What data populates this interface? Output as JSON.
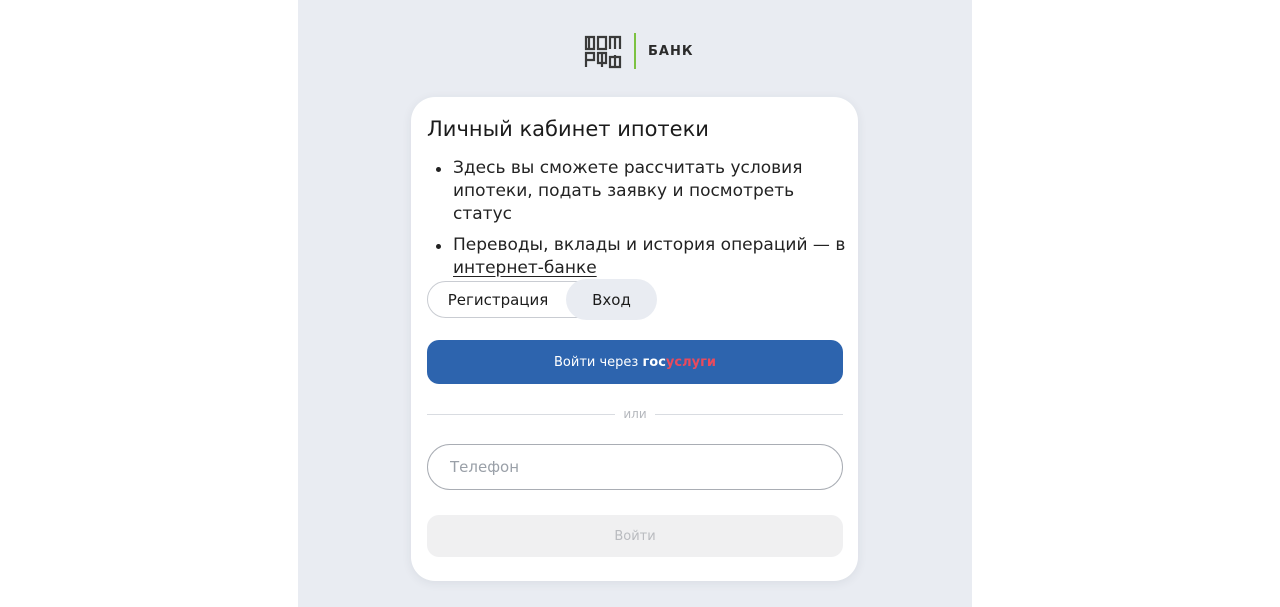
{
  "brand": {
    "logo_icon": "dom-rf-logo-icon",
    "name": "БАНК",
    "accent_color": "#7cc242"
  },
  "card": {
    "title": "Личный кабинет ипотеки",
    "bullets": [
      {
        "text": "Здесь вы сможете рассчитать условия ипотеки, подать заявку и посмотреть статус"
      },
      {
        "text": "Переводы, вклады и история операций — в ",
        "link": "интернет-банке"
      }
    ]
  },
  "tabs": {
    "register": "Регистрация",
    "login": "Вход",
    "active": "login"
  },
  "gosuslugi_button": {
    "prefix": "Войти через ",
    "brand_part1": "гос",
    "brand_part2": "услуги",
    "color": "#2d64ae"
  },
  "divider": {
    "text": "или"
  },
  "phone": {
    "placeholder": "Телефон",
    "value": ""
  },
  "submit": {
    "label": "Войти",
    "disabled": true
  }
}
